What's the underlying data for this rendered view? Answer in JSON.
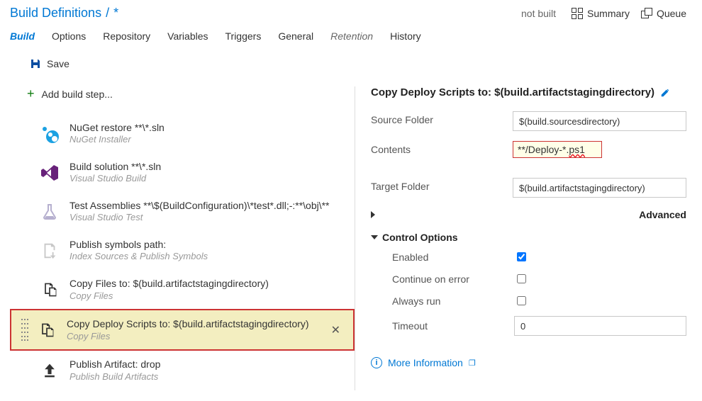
{
  "header": {
    "breadcrumb_root": "Build Definitions",
    "breadcrumb_sep": "/",
    "breadcrumb_current": "*",
    "not_built": "not built",
    "summary": "Summary",
    "queue": "Queue"
  },
  "tabs": [
    "Build",
    "Options",
    "Repository",
    "Variables",
    "Triggers",
    "General",
    "Retention",
    "History"
  ],
  "save_label": "Save",
  "add_step_label": "Add build step...",
  "steps": [
    {
      "title": "NuGet restore **\\*.sln",
      "sub": "NuGet Installer"
    },
    {
      "title": "Build solution **\\*.sln",
      "sub": "Visual Studio Build"
    },
    {
      "title": "Test Assemblies **\\$(BuildConfiguration)\\*test*.dll;-:**\\obj\\**",
      "sub": "Visual Studio Test"
    },
    {
      "title": "Publish symbols path:",
      "sub": "Index Sources & Publish Symbols"
    },
    {
      "title": "Copy Files to: $(build.artifactstagingdirectory)",
      "sub": "Copy Files"
    },
    {
      "title": "Copy Deploy Scripts to: $(build.artifactstagingdirectory)",
      "sub": "Copy Files"
    },
    {
      "title": "Publish Artifact: drop",
      "sub": "Publish Build Artifacts"
    }
  ],
  "panel": {
    "title": "Copy Deploy Scripts to: $(build.artifactstagingdirectory)",
    "source_label": "Source Folder",
    "source_value": "$(build.sourcesdirectory)",
    "contents_label": "Contents",
    "contents_prefix": "**/Deploy-*.",
    "contents_suffix": "ps1",
    "target_label": "Target Folder",
    "target_value": "$(build.artifactstagingdirectory)",
    "advanced": "Advanced",
    "control_options": "Control Options",
    "enabled": "Enabled",
    "cont_err": "Continue on error",
    "always": "Always run",
    "timeout": "Timeout",
    "timeout_value": "0",
    "more_info": "More Information"
  }
}
